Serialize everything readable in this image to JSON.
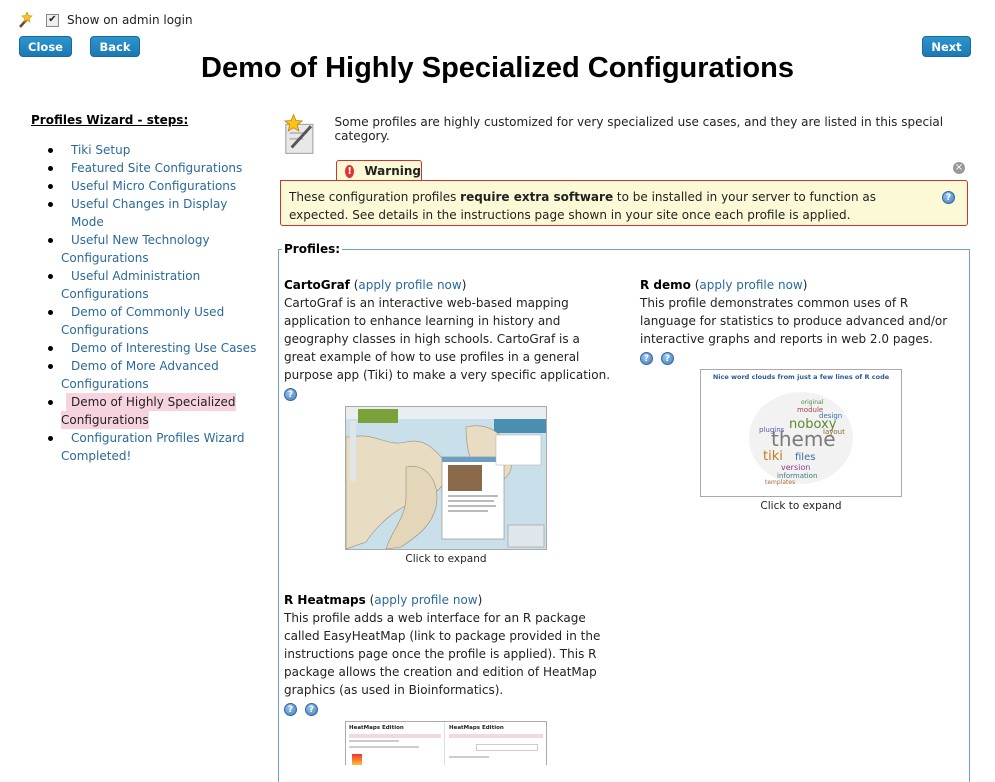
{
  "topbar": {
    "wand_icon": "wand-icon",
    "show_on_login_label": "Show on admin login",
    "checked": true
  },
  "buttons": {
    "close": "Close",
    "back": "Back",
    "next": "Next"
  },
  "page_title": "Demo of Highly Specialized Configurations",
  "sidebar": {
    "title": "Profiles Wizard - steps:",
    "steps": [
      {
        "label": "Tiki Setup"
      },
      {
        "label": "Featured Site Configurations"
      },
      {
        "label": "Useful Micro Configurations"
      },
      {
        "label": "Useful Changes in Display Mode"
      },
      {
        "label_1": "Useful New Technology",
        "label_2": "Configurations"
      },
      {
        "label_1": "Useful Administration",
        "label_2": "Configurations"
      },
      {
        "label_1": "Demo of Commonly Used",
        "label_2": "Configurations"
      },
      {
        "label": "Demo of Interesting Use Cases"
      },
      {
        "label_1": "Demo of More Advanced",
        "label_2": "Configurations"
      },
      {
        "label_1": "Demo of Highly Specialized",
        "label_2": "Configurations",
        "active": true
      },
      {
        "label_1": "Configuration Profiles Wizard",
        "label_2": "Completed!"
      }
    ]
  },
  "intro": {
    "text": "Some profiles are highly customized for very specialized use cases, and they are listed in this special category."
  },
  "warning": {
    "tab_label": "Warning",
    "text_before": "These configuration profiles ",
    "text_bold": "require extra software",
    "text_after": " to be installed in your server to function as expected. See details in the instructions page shown in your site once each profile is applied."
  },
  "profiles": {
    "legend": "Profiles:",
    "apply_label": "apply profile now",
    "items": [
      {
        "name": "CartoGraf",
        "description": "CartoGraf is an interactive web-based mapping application to enhance learning in history and geography classes in high schools. CartoGraf is a great example of how to use profiles in a general purpose app (Tiki) to make a very specific application.",
        "caption": "Click to expand"
      },
      {
        "name": "R demo",
        "description": "This profile demonstrates common uses of R language for statistics to produce advanced and/or interactive graphs and reports in web 2.0 pages.",
        "caption": "Click to expand",
        "thumb_title": "Nice word clouds from just a few lines of R code"
      },
      {
        "name": "R Heatmaps",
        "description": "This profile adds a web interface for an R package called EasyHeatMap (link to package provided in the instructions page once the profile is applied). This R package allows the creation and edition of HeatMap graphics (as used in Bioinformatics).",
        "thumb_titles": [
          "HeatMaps Edition",
          "HeatMaps Edition"
        ]
      }
    ]
  },
  "colors": {
    "button": "#1b79b4",
    "link": "#2a6a9a",
    "warning_border": "#cc3333",
    "warning_bg": "#fbf9d6",
    "active_step_bg": "#f7d3e0"
  }
}
